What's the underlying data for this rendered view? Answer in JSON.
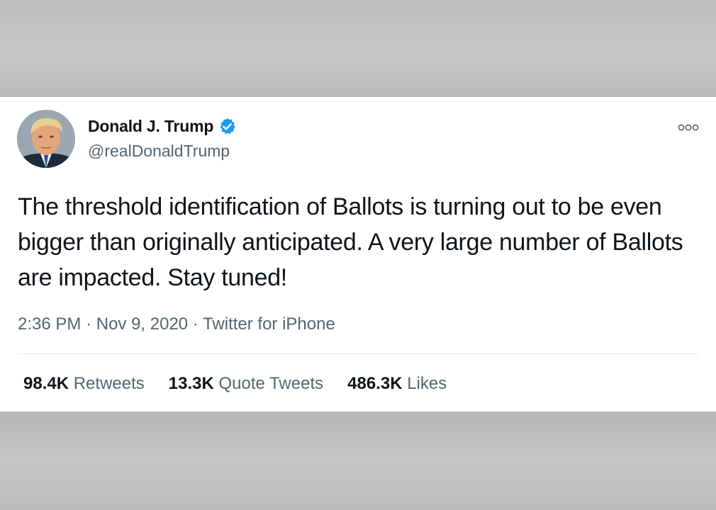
{
  "tweet": {
    "author": {
      "display_name": "Donald J. Trump",
      "handle": "@realDonaldTrump",
      "verified": true
    },
    "text": "The threshold identification of Ballots is turning out to be even bigger than originally anticipated. A very large number of Ballots are impacted. Stay tuned!",
    "meta": {
      "time": "2:36 PM",
      "separator": "·",
      "date": "Nov 9, 2020",
      "source": "Twitter for iPhone"
    },
    "stats": [
      {
        "count": "98.4K",
        "label": "Retweets"
      },
      {
        "count": "13.3K",
        "label": "Quote Tweets"
      },
      {
        "count": "486.3K",
        "label": "Likes"
      }
    ],
    "icons": {
      "verified": "verified-badge-icon",
      "more": "more-options-icon"
    },
    "colors": {
      "verified_blue": "#1d9bf0",
      "primary_text": "#0f1419",
      "secondary_text": "#536471"
    }
  }
}
